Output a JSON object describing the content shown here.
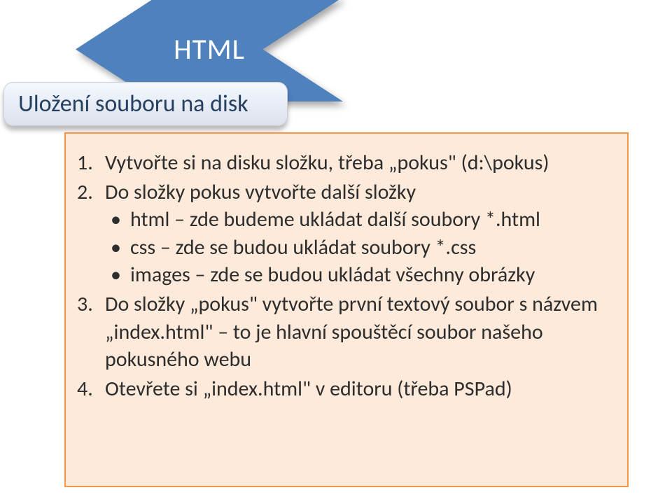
{
  "arrow": {
    "label": "HTML"
  },
  "title": {
    "text": "Uložení souboru na disk"
  },
  "body": {
    "items": [
      {
        "text": "Vytvořte si na disku složku, třeba „pokus\" (d:\\pokus)"
      },
      {
        "text": "Do složky pokus vytvořte další složky",
        "sub": [
          "html – zde budeme ukládat další soubory *.html",
          "css – zde se budou ukládat soubory *.css",
          "images – zde se budou ukládat všechny obrázky"
        ]
      },
      {
        "text": "Do složky „pokus\" vytvořte první textový soubor s názvem „index.html\" – to je hlavní spouštěcí soubor našeho pokusného webu"
      },
      {
        "text": "Otevřete si „index.html\" v editoru (třeba PSPad)"
      }
    ]
  }
}
